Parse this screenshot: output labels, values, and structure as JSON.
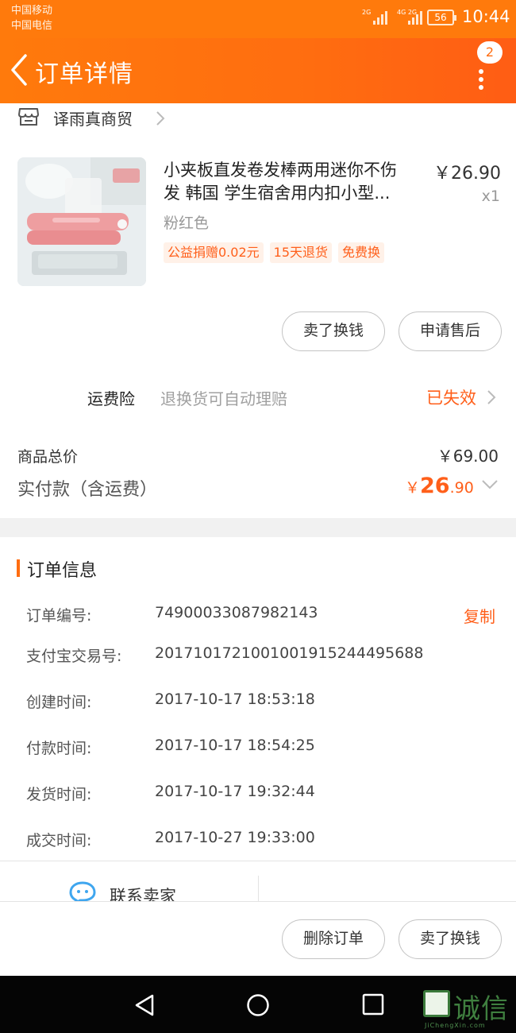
{
  "status_bar": {
    "carrier_1": "中国移动",
    "carrier_2": "中国电信",
    "signal_1_label": "2G",
    "signal_2_label": "4G 2G",
    "battery": "56",
    "time": "10:44"
  },
  "header": {
    "title": "订单详情",
    "badge_count": "2"
  },
  "shop": {
    "name": "译雨真商贸"
  },
  "product": {
    "title_line_1": "小夹板直发卷发棒两用迷你不伤",
    "title_line_2": "发 韩国 学生宿舍用内扣小型...",
    "price": "￥26.90",
    "quantity": "x1",
    "sku": "粉红色",
    "tags": [
      "公益捐赠0.02元",
      "15天退货",
      "免费换"
    ]
  },
  "item_actions": {
    "sell_label": "卖了换钱",
    "aftersale_label": "申请售后"
  },
  "insurance": {
    "label": "运费险",
    "description": "退换货可自动理赔",
    "status": "已失效"
  },
  "summary": {
    "total_label": "商品总价",
    "total_value": "￥69.00",
    "paid_label": "实付款（含运费）",
    "paid_currency": "￥",
    "paid_integer": "26",
    "paid_decimal": ".90"
  },
  "order_info": {
    "title": "订单信息",
    "copy_label": "复制",
    "rows": [
      {
        "key": "订单编号:",
        "value": "74900033087982143"
      },
      {
        "key": "支付宝交易号:",
        "value": "2017101721001001915244495688"
      },
      {
        "key": "创建时间:",
        "value": "2017-10-17 18:53:18"
      },
      {
        "key": "付款时间:",
        "value": "2017-10-17 18:54:25"
      },
      {
        "key": "发货时间:",
        "value": "2017-10-17 19:32:44"
      },
      {
        "key": "成交时间:",
        "value": "2017-10-27 19:33:00"
      }
    ]
  },
  "contact": {
    "label": "联系卖家"
  },
  "bottom_actions": {
    "delete_label": "删除订单",
    "sell_label": "卖了换钱"
  },
  "watermark": {
    "text": "诚信",
    "sub": "JiChengXin.com"
  },
  "colors": {
    "brand_orange": "#ff7a0c",
    "accent_red_orange": "#ff5f1a"
  }
}
